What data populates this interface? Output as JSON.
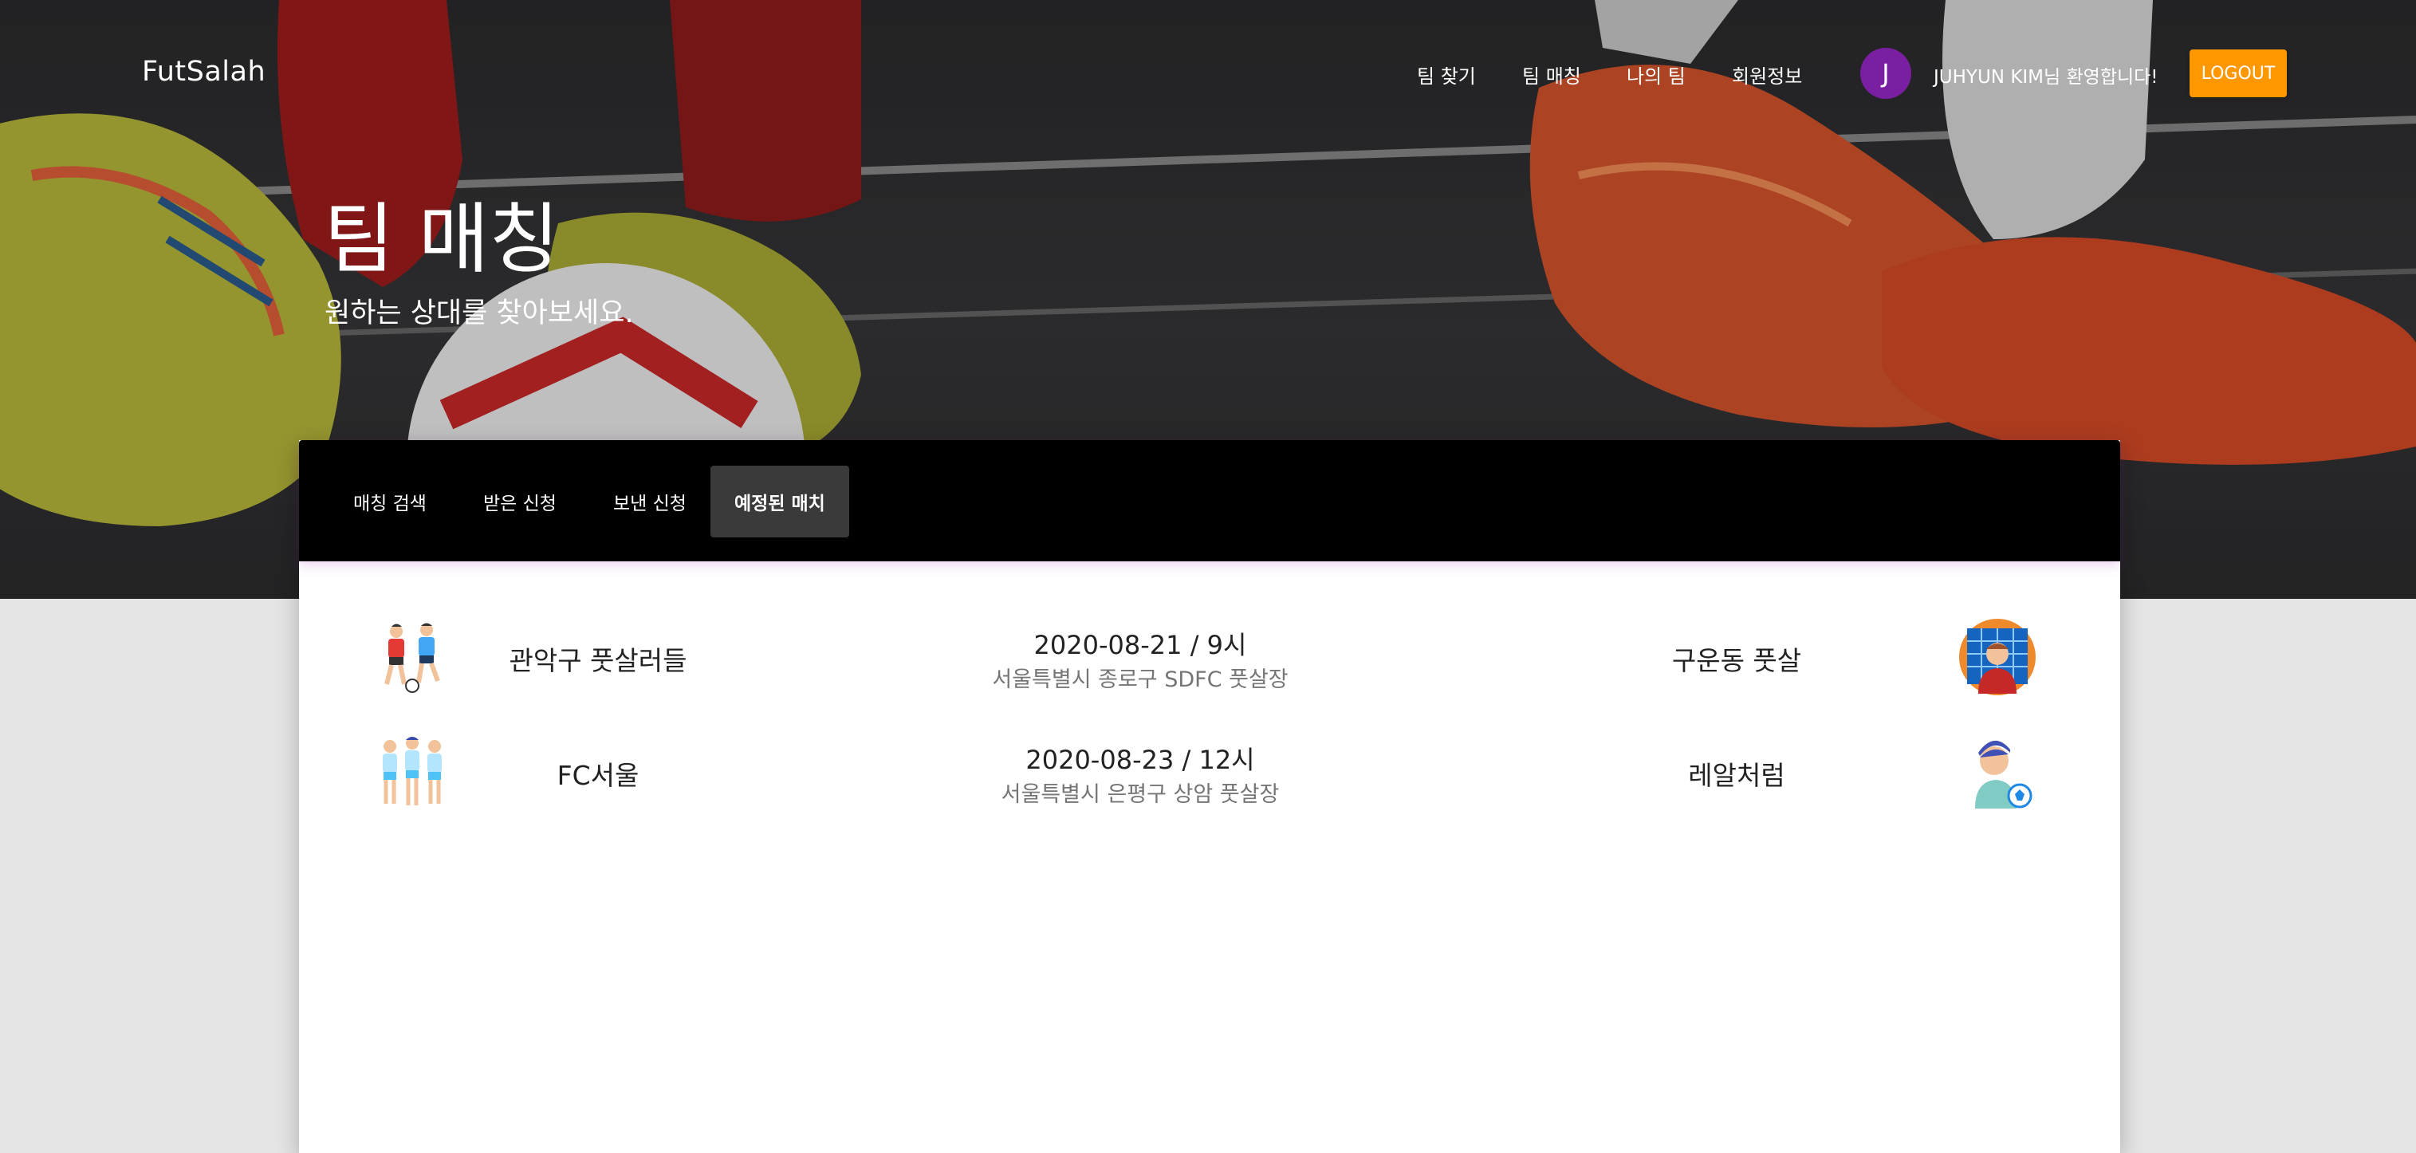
{
  "brand": "FutSalah",
  "nav": {
    "links": [
      "팀 찾기",
      "팀 매칭",
      "나의 팀",
      "회원정보"
    ],
    "avatar_initial": "J",
    "avatar_color": "#7b1fa2",
    "welcome": "JUHYUN KIM님 환영합니다!",
    "logout_label": "LOGOUT",
    "logout_color": "#ff9800"
  },
  "hero": {
    "title": "팀 매칭",
    "subtitle": "원하는 상대를 찾아보세요."
  },
  "tabs": [
    {
      "label": "매칭 검색",
      "active": false
    },
    {
      "label": "받은 신청",
      "active": false
    },
    {
      "label": "보낸 신청",
      "active": false
    },
    {
      "label": "예정된 매치",
      "active": true
    }
  ],
  "matches": [
    {
      "home_team": "관악구 풋살러들",
      "home_icon": "soccer-players-icon",
      "date": "2020-08-21 / 9시",
      "place": "서울특별시 종로구 SDFC 풋살장",
      "away_team": "구운동 풋살",
      "away_icon": "goalkeeper-icon"
    },
    {
      "home_team": "FC서울",
      "home_icon": "team-players-icon",
      "date": "2020-08-23 / 12시",
      "place": "서울특별시 은평구 상암 풋살장",
      "away_team": "레알처럼",
      "away_icon": "player-with-ball-icon"
    }
  ]
}
